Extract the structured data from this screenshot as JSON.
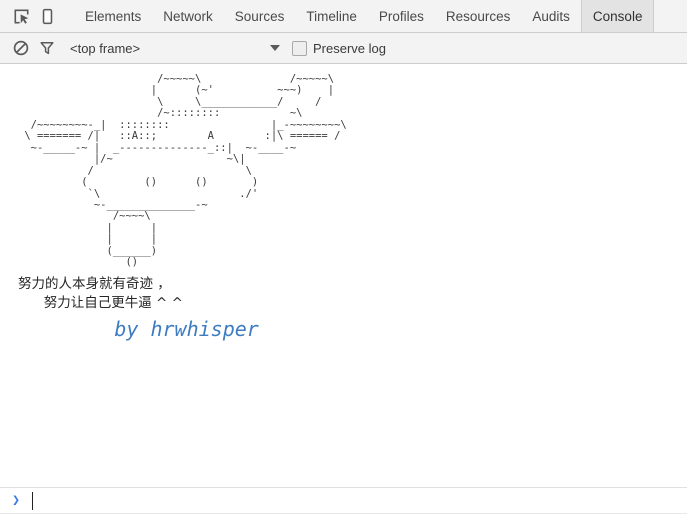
{
  "tabbar": {
    "inspect_icon": "inspect-element-icon",
    "device_icon": "device-toolbar-icon",
    "tabs": [
      {
        "label": "Elements",
        "active": false
      },
      {
        "label": "Network",
        "active": false
      },
      {
        "label": "Sources",
        "active": false
      },
      {
        "label": "Timeline",
        "active": false
      },
      {
        "label": "Profiles",
        "active": false
      },
      {
        "label": "Resources",
        "active": false
      },
      {
        "label": "Audits",
        "active": false
      },
      {
        "label": "Console",
        "active": true
      }
    ]
  },
  "filterbar": {
    "clear_icon": "clear-console-icon",
    "filter_icon": "filter-funnel-icon",
    "frame_value": "<top frame>",
    "preserve_log_label": "Preserve log",
    "preserve_log_checked": false
  },
  "console": {
    "ascii_art": "                      /~~~~~\\              /~~~~~\\\n                     |      (~'          ~~~)    |\n                      \\     \\____________/     /\n                      /~::::::::           ~\\\n  /~~~~~~~~-_|  ::::::::                |_-~~~~~~~~\\\n \\ ======= /|   ::A::;        A        :|\\ ====== /\n  ~-_____-~ |  _--------------_::|  ~-____-~\n            |/~                  ~\\|\n           /                        \\\n          (         ()      ()       )\n           `\\                      ./'\n            ~-______________-~\n               /~~~~\\\n              |      |\n              |      |\n              (______)\n                 ()",
    "cn_line_1": "努力的人本身就有奇迹 ，",
    "cn_line_2": "      努力让自己更牛逼 ^ ^",
    "signature": "        by hrwhisper",
    "signature_color": "#3e7cc0"
  },
  "prompt": {
    "chevron": "❯",
    "value": "",
    "placeholder": ""
  }
}
